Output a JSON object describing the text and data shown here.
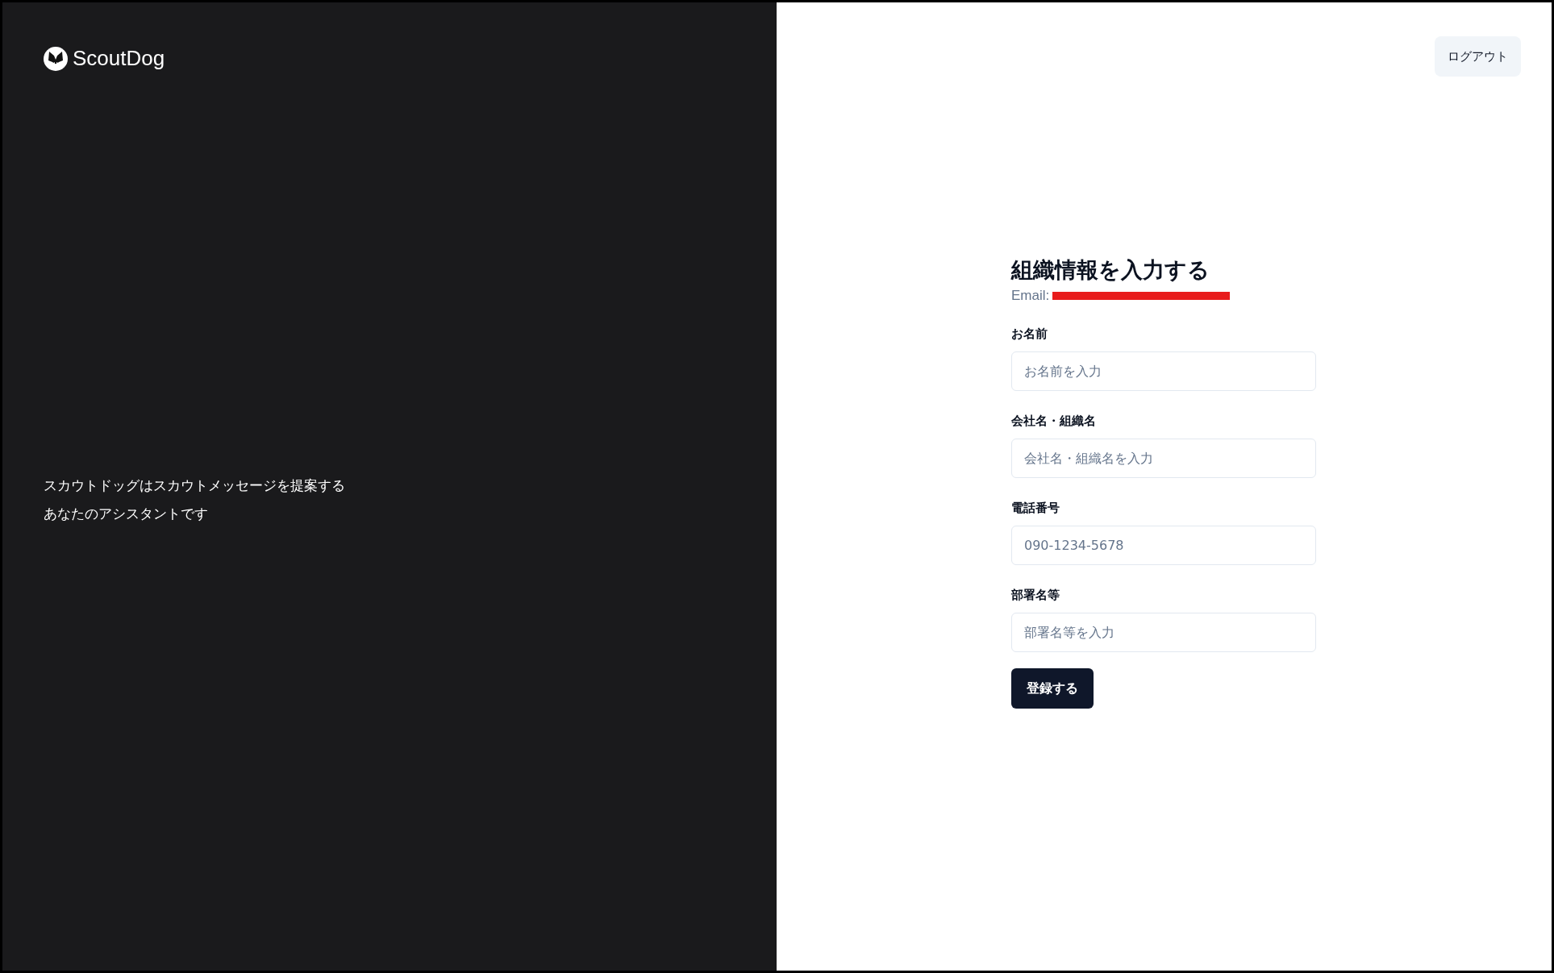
{
  "brand": {
    "name": "ScoutDog"
  },
  "tagline": [
    "スカウトドッグはスカウトメッセージを提案する",
    "あなたのアシスタントです"
  ],
  "logout_button": "ログアウト",
  "form": {
    "title": "組織情報を入力する",
    "email_label": "Email:",
    "email_redacted": true,
    "fields": [
      {
        "label": "お名前",
        "placeholder": "お名前を入力"
      },
      {
        "label": "会社名・組織名",
        "placeholder": "会社名・組織名を入力"
      },
      {
        "label": "電話番号",
        "placeholder": "090-1234-5678"
      },
      {
        "label": "部署名等",
        "placeholder": "部署名等を入力"
      }
    ],
    "submit": "登録する"
  }
}
